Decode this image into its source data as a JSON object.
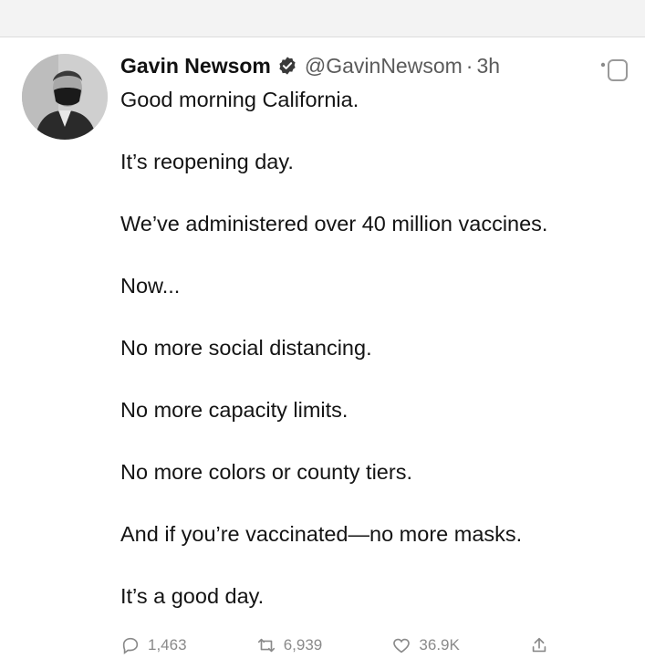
{
  "author": {
    "name": "Gavin Newsom",
    "handle": "@GavinNewsom",
    "separator": "·",
    "time": "3h"
  },
  "tweet": {
    "lines": [
      "Good morning California.",
      "It’s reopening day.",
      "We’ve administered over 40 million vaccines.",
      "Now...",
      "No more social distancing.",
      "No more capacity limits.",
      "No more colors or county tiers.",
      "And if you’re vaccinated—no more masks.",
      "It’s a good day."
    ]
  },
  "actions": {
    "reply": {
      "icon": "reply-icon",
      "count": "1,463"
    },
    "retweet": {
      "icon": "retweet-icon",
      "count": "6,939"
    },
    "like": {
      "icon": "heart-icon",
      "count": "36.9K"
    },
    "share": {
      "icon": "share-icon"
    }
  },
  "colors": {
    "verified": "#1d9bf0",
    "text": "#141414",
    "muted": "#5b5b5b"
  }
}
